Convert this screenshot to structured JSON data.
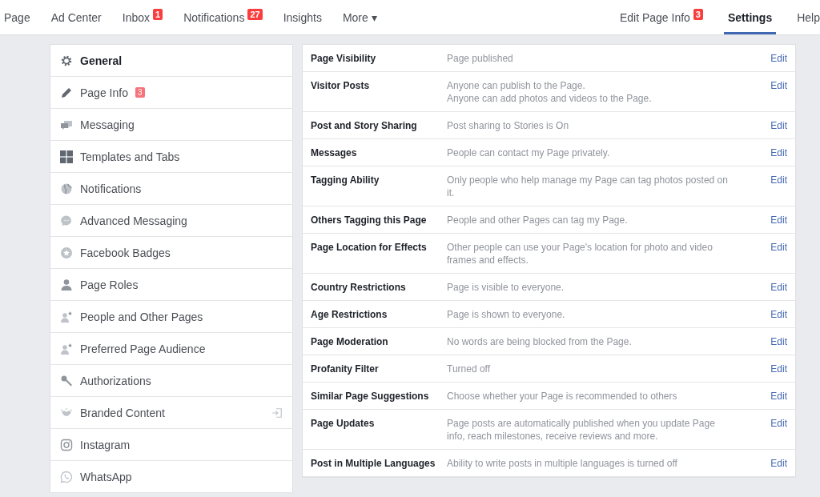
{
  "top_nav": {
    "left": [
      {
        "label": "Page",
        "selected": false
      },
      {
        "label": "Ad Center",
        "selected": false
      },
      {
        "label": "Inbox",
        "badge": "1",
        "selected": false
      },
      {
        "label": "Notifications",
        "badge": "27",
        "selected": false
      },
      {
        "label": "Insights",
        "selected": false
      },
      {
        "label": "More ▾",
        "selected": false
      }
    ],
    "right": [
      {
        "label": "Edit Page Info",
        "badge": "3",
        "selected": false
      },
      {
        "label": "Settings",
        "selected": true
      },
      {
        "label": "Help",
        "selected": false
      }
    ]
  },
  "sidebar": {
    "items": [
      {
        "label": "General",
        "selected": true,
        "external": false
      },
      {
        "label": "Page Info",
        "badge": "3",
        "selected": false,
        "external": false
      },
      {
        "label": "Messaging",
        "selected": false,
        "external": false
      },
      {
        "label": "Templates and Tabs",
        "selected": false,
        "external": false
      },
      {
        "label": "Notifications",
        "selected": false,
        "external": false
      },
      {
        "label": "Advanced Messaging",
        "selected": false,
        "external": false
      },
      {
        "label": "Facebook Badges",
        "selected": false,
        "external": false
      },
      {
        "label": "Page Roles",
        "selected": false,
        "external": false
      },
      {
        "label": "People and Other Pages",
        "selected": false,
        "external": false
      },
      {
        "label": "Preferred Page Audience",
        "selected": false,
        "external": false
      },
      {
        "label": "Authorizations",
        "selected": false,
        "external": false
      },
      {
        "label": "Branded Content",
        "selected": false,
        "external": true
      },
      {
        "label": "Instagram",
        "selected": false,
        "external": false
      },
      {
        "label": "WhatsApp",
        "selected": false,
        "external": false
      }
    ]
  },
  "settings": {
    "rows": [
      {
        "label": "Page Visibility",
        "value": [
          "Page published"
        ],
        "action": "Edit"
      },
      {
        "label": "Visitor Posts",
        "value": [
          "Anyone can publish to the Page.",
          "Anyone can add photos and videos to the Page."
        ],
        "action": "Edit"
      },
      {
        "label": "Post and Story Sharing",
        "value": [
          "Post sharing to Stories is On"
        ],
        "action": "Edit"
      },
      {
        "label": "Messages",
        "value": [
          "People can contact my Page privately."
        ],
        "action": "Edit"
      },
      {
        "label": "Tagging Ability",
        "value": [
          "Only people who help manage my Page can tag photos posted on it."
        ],
        "action": "Edit"
      },
      {
        "label": "Others Tagging this Page",
        "value": [
          "People and other Pages can tag my Page."
        ],
        "action": "Edit"
      },
      {
        "label": "Page Location for Effects",
        "value": [
          "Other people can use your Page's location for photo and video frames and effects."
        ],
        "action": "Edit"
      },
      {
        "label": "Country Restrictions",
        "value": [
          "Page is visible to everyone."
        ],
        "action": "Edit"
      },
      {
        "label": "Age Restrictions",
        "value": [
          "Page is shown to everyone."
        ],
        "action": "Edit"
      },
      {
        "label": "Page Moderation",
        "value": [
          "No words are being blocked from the Page."
        ],
        "action": "Edit"
      },
      {
        "label": "Profanity Filter",
        "value": [
          "Turned off"
        ],
        "action": "Edit"
      },
      {
        "label": "Similar Page Suggestions",
        "value": [
          "Choose whether your Page is recommended to others"
        ],
        "action": "Edit"
      },
      {
        "label": "Page Updates",
        "value": [
          "Page posts are automatically published when you update Page info, reach milestones, receive reviews and more."
        ],
        "action": "Edit"
      },
      {
        "label": "Post in Multiple Languages",
        "value": [
          "Ability to write posts in multiple languages is turned off"
        ],
        "action": "Edit"
      }
    ]
  }
}
